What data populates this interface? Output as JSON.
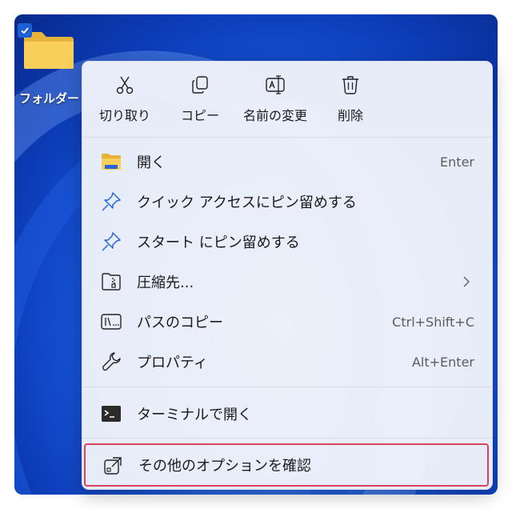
{
  "desktop": {
    "folder": {
      "label": "フォルダー",
      "checked": true
    }
  },
  "menu": {
    "toolbar": [
      {
        "name": "cut",
        "label": "切り取り",
        "icon": "scissors-icon"
      },
      {
        "name": "copy",
        "label": "コピー",
        "icon": "copy-icon"
      },
      {
        "name": "rename",
        "label": "名前の変更",
        "icon": "rename-icon"
      },
      {
        "name": "delete",
        "label": "削除",
        "icon": "trash-icon"
      }
    ],
    "items": [
      {
        "name": "open",
        "label": "開く",
        "shortcut": "Enter",
        "icon": "folder-icon"
      },
      {
        "name": "pin-quick-access",
        "label": "クイック アクセスにピン留めする",
        "shortcut": "",
        "icon": "pin-icon"
      },
      {
        "name": "pin-start",
        "label": "スタート にピン留めする",
        "shortcut": "",
        "icon": "pin-icon"
      },
      {
        "name": "compress",
        "label": "圧縮先...",
        "shortcut": "",
        "icon": "zip-folder-icon",
        "submenu": true
      },
      {
        "name": "copy-path",
        "label": "パスのコピー",
        "shortcut": "Ctrl+Shift+C",
        "icon": "path-icon"
      },
      {
        "name": "properties",
        "label": "プロパティ",
        "shortcut": "Alt+Enter",
        "icon": "wrench-icon"
      }
    ],
    "terminal": {
      "label": "ターミナルで開く",
      "icon": "terminal-icon"
    },
    "more_options": {
      "label": "その他のオプションを確認",
      "icon": "share-icon",
      "highlighted": true
    }
  },
  "colors": {
    "highlight_border": "#d9435e",
    "checkbox": "#1f5fd6",
    "folder": "#f6c94a"
  }
}
